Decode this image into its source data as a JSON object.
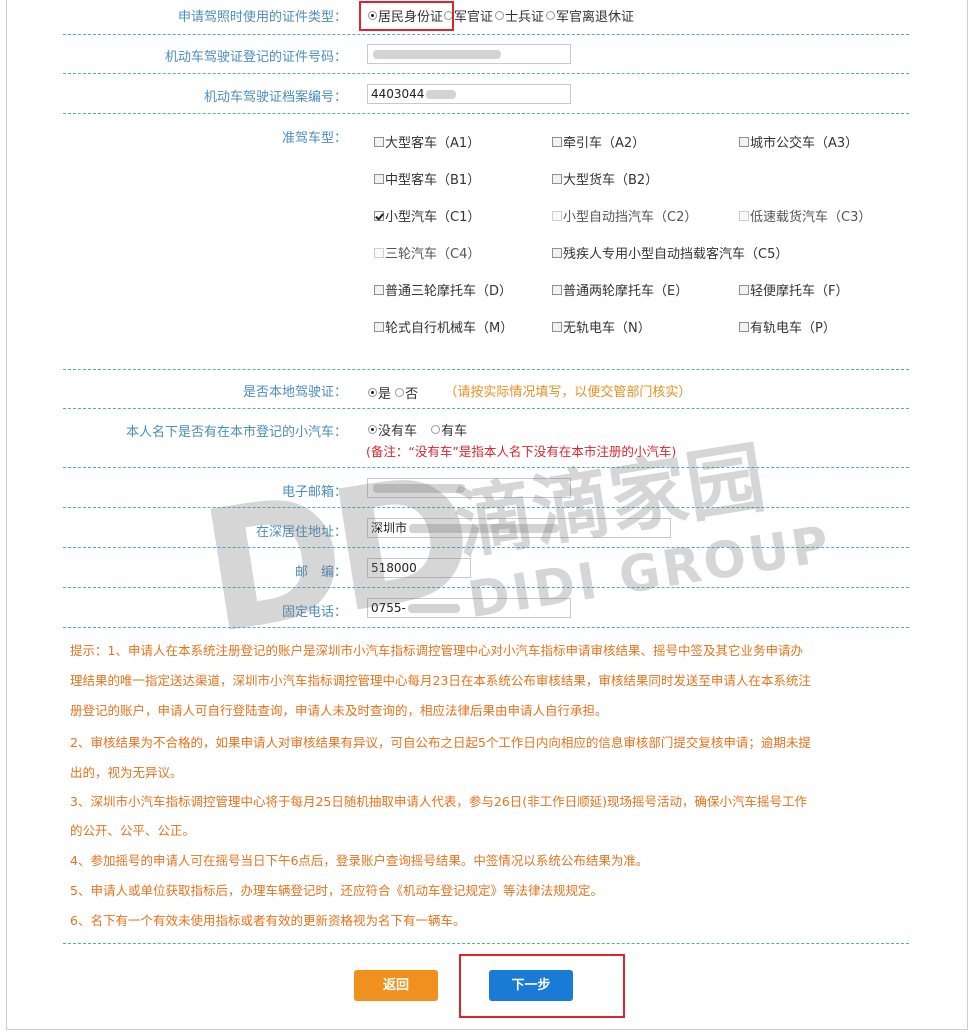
{
  "license_type": {
    "label": "申请驾照时使用的证件类型：",
    "options": [
      "居民身份证",
      "军官证",
      "士兵证",
      "军官离退休证"
    ],
    "selected": "居民身份证"
  },
  "id_number": {
    "label": "机动车驾驶证登记的证件号码："
  },
  "file_number": {
    "label": "机动车驾驶证档案编号：",
    "value": "4403044"
  },
  "vehicle_class": {
    "label": "准驾车型：",
    "items": [
      {
        "text": "大型客车（A1）",
        "checked": false,
        "disabled": false
      },
      {
        "text": "牵引车（A2）",
        "checked": false,
        "disabled": false
      },
      {
        "text": "城市公交车（A3）",
        "checked": false,
        "disabled": false
      },
      {
        "text": "中型客车（B1）",
        "checked": false,
        "disabled": false
      },
      {
        "text": "大型货车（B2）",
        "checked": false,
        "disabled": false
      },
      {
        "text": "小型汽车（C1）",
        "checked": true,
        "disabled": false
      },
      {
        "text": "小型自动挡汽车（C2）",
        "checked": false,
        "disabled": true
      },
      {
        "text": "低速载货汽车（C3）",
        "checked": false,
        "disabled": true
      },
      {
        "text": "三轮汽车（C4）",
        "checked": false,
        "disabled": true
      },
      {
        "text": "残疾人专用小型自动挡载客汽车（C5）",
        "checked": false,
        "disabled": false
      },
      {
        "text": "普通三轮摩托车（D）",
        "checked": false,
        "disabled": false
      },
      {
        "text": "普通两轮摩托车（E）",
        "checked": false,
        "disabled": false
      },
      {
        "text": "轻便摩托车（F）",
        "checked": false,
        "disabled": false
      },
      {
        "text": "轮式自行机械车（M）",
        "checked": false,
        "disabled": false
      },
      {
        "text": "无轨电车（N）",
        "checked": false,
        "disabled": false
      },
      {
        "text": "有轨电车（P）",
        "checked": false,
        "disabled": false
      }
    ]
  },
  "local_license": {
    "label": "是否本地驾驶证：",
    "opt_yes": "是",
    "opt_no": "否",
    "selected": "是",
    "hint": "（请按实际情况填写，以便交管部门核实）"
  },
  "has_car": {
    "label": "本人名下是否有在本市登记的小汽车：",
    "opt_no": "没有车",
    "opt_yes": "有车",
    "selected": "没有车",
    "note": "(备注：“没有车”是指本人名下没有在本市注册的小汽车)"
  },
  "email": {
    "label": "电子邮箱："
  },
  "address": {
    "label": "在深居住地址：",
    "value": "深圳市"
  },
  "postcode": {
    "label": "邮　编：",
    "value": "518000"
  },
  "phone": {
    "label": "固定电话：",
    "value": "0755-"
  },
  "tips": [
    "提示：1、申请人在本系统注册登记的账户是深圳市小汽车指标调控管理中心对小汽车指标申请审核结果、摇号中签及其它业务申请办",
    "理结果的唯一指定送达渠道，深圳市小汽车指标调控管理中心每月23日在本系统公布审核结果，审核结果同时发送至申请人在本系统注",
    "册登记的账户，申请人可自行登陆查询，申请人未及时查询的，相应法律后果由申请人自行承担。",
    "2、审核结果为不合格的，如果申请人对审核结果有异议，可自公布之日起5个工作日内向相应的信息审核部门提交复核申请；逾期未提",
    "出的，视为无异议。",
    "3、深圳市小汽车指标调控管理中心将于每月25日随机抽取申请人代表，参与26日(非工作日顺延)现场摇号活动，确保小汽车摇号工作",
    "的公开、公平、公正。",
    "4、参加摇号的申请人可在摇号当日下午6点后，登录账户查询摇号结果。中签情况以系统公布结果为准。",
    "5、申请人或单位获取指标后，办理车辆登记时，还应符合《机动车登记规定》等法律法规规定。",
    "6、名下有一个有效未使用指标或者有效的更新资格视为名下有一辆车。"
  ],
  "buttons": {
    "back": "返回",
    "next": "下一步"
  },
  "watermark": {
    "big": "DD",
    "cn": "滴滴家园",
    "en": "DIDI GROUP"
  },
  "colors": {
    "label": "#4a8ec0",
    "tip": "#e8731d",
    "note_red": "#d9262c",
    "back_btn": "#f0901e",
    "next_btn": "#1a7bd6",
    "highlight": "#e0242c"
  }
}
